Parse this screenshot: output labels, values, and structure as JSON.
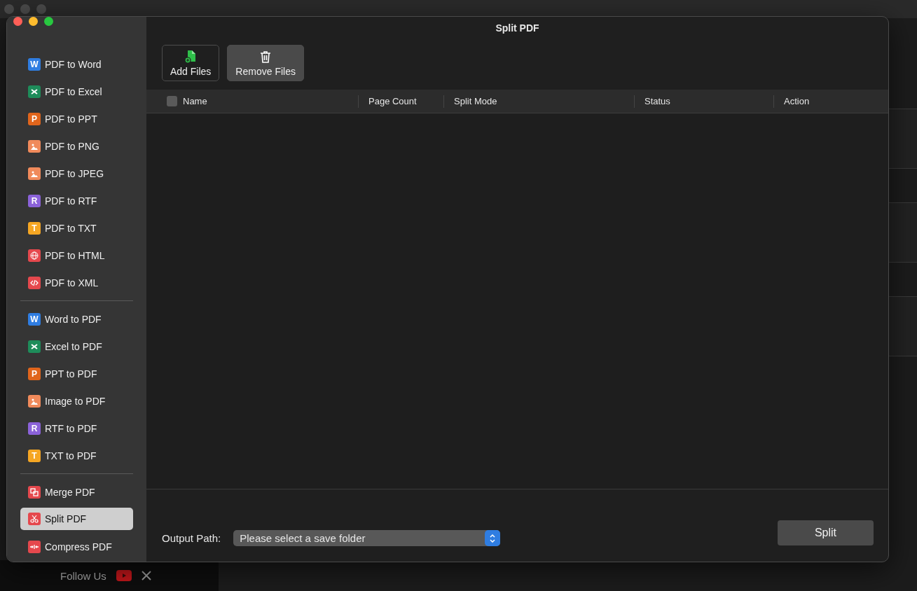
{
  "window": {
    "title": "Split PDF"
  },
  "sidebar": {
    "groups": [
      [
        {
          "label": "PDF to Word",
          "kind": "letter",
          "glyph": "W",
          "color": "#2f7de1",
          "selected": false
        },
        {
          "label": "PDF to Excel",
          "kind": "cross",
          "color": "#1e8c5a",
          "selected": false
        },
        {
          "label": "PDF to PPT",
          "kind": "letter",
          "glyph": "P",
          "color": "#e0651c",
          "selected": false
        },
        {
          "label": "PDF to PNG",
          "kind": "image",
          "color": "#f08a5b",
          "selected": false
        },
        {
          "label": "PDF to JPEG",
          "kind": "image",
          "color": "#f08a5b",
          "selected": false
        },
        {
          "label": "PDF to RTF",
          "kind": "letter",
          "glyph": "R",
          "color": "#8b62d9",
          "selected": false
        },
        {
          "label": "PDF to TXT",
          "kind": "letter",
          "glyph": "T",
          "color": "#f5a623",
          "selected": false
        },
        {
          "label": "PDF to HTML",
          "kind": "globe",
          "color": "#e5484d",
          "selected": false
        },
        {
          "label": "PDF to XML",
          "kind": "code",
          "color": "#e5484d",
          "selected": false
        }
      ],
      [
        {
          "label": "Word to PDF",
          "kind": "letter",
          "glyph": "W",
          "color": "#2f7de1",
          "selected": false
        },
        {
          "label": "Excel to PDF",
          "kind": "cross",
          "color": "#1e8c5a",
          "selected": false
        },
        {
          "label": "PPT to PDF",
          "kind": "letter",
          "glyph": "P",
          "color": "#e0651c",
          "selected": false
        },
        {
          "label": "Image to PDF",
          "kind": "image",
          "color": "#f08a5b",
          "selected": false
        },
        {
          "label": "RTF to PDF",
          "kind": "letter",
          "glyph": "R",
          "color": "#8b62d9",
          "selected": false
        },
        {
          "label": "TXT to PDF",
          "kind": "letter",
          "glyph": "T",
          "color": "#f5a623",
          "selected": false
        }
      ],
      [
        {
          "label": "Merge PDF",
          "kind": "merge",
          "color": "#e5484d",
          "selected": false
        },
        {
          "label": "Split PDF",
          "kind": "scissors",
          "color": "#e5484d",
          "selected": true
        },
        {
          "label": "Compress PDF",
          "kind": "compress",
          "color": "#e5484d",
          "selected": false
        }
      ]
    ]
  },
  "toolbar": [
    {
      "label": "Add Files",
      "kind": "add",
      "selected": false
    },
    {
      "label": "Remove Files",
      "kind": "remove",
      "selected": true
    }
  ],
  "table": {
    "select_all": {
      "checked": false
    },
    "columns": [
      "Name",
      "Page Count",
      "Split Mode",
      "Status",
      "Action"
    ]
  },
  "output": {
    "label": "Output Path:",
    "value": "Please select a save folder"
  },
  "action_button": "Split",
  "background_app": {
    "follow_label": "Follow Us"
  }
}
